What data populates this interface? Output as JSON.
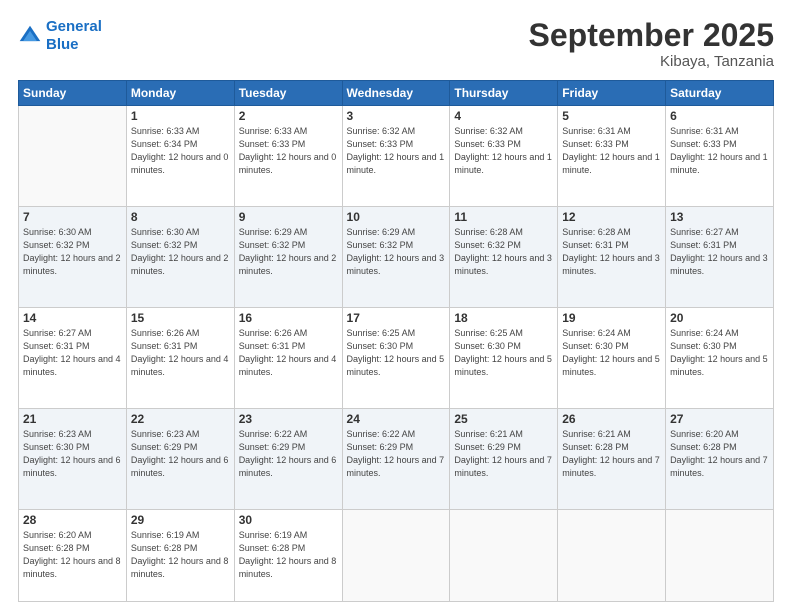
{
  "logo": {
    "line1": "General",
    "line2": "Blue"
  },
  "title": "September 2025",
  "location": "Kibaya, Tanzania",
  "headers": [
    "Sunday",
    "Monday",
    "Tuesday",
    "Wednesday",
    "Thursday",
    "Friday",
    "Saturday"
  ],
  "weeks": [
    [
      {
        "day": "",
        "sunrise": "",
        "sunset": "",
        "daylight": ""
      },
      {
        "day": "1",
        "sunrise": "Sunrise: 6:33 AM",
        "sunset": "Sunset: 6:34 PM",
        "daylight": "Daylight: 12 hours and 0 minutes."
      },
      {
        "day": "2",
        "sunrise": "Sunrise: 6:33 AM",
        "sunset": "Sunset: 6:33 PM",
        "daylight": "Daylight: 12 hours and 0 minutes."
      },
      {
        "day": "3",
        "sunrise": "Sunrise: 6:32 AM",
        "sunset": "Sunset: 6:33 PM",
        "daylight": "Daylight: 12 hours and 1 minute."
      },
      {
        "day": "4",
        "sunrise": "Sunrise: 6:32 AM",
        "sunset": "Sunset: 6:33 PM",
        "daylight": "Daylight: 12 hours and 1 minute."
      },
      {
        "day": "5",
        "sunrise": "Sunrise: 6:31 AM",
        "sunset": "Sunset: 6:33 PM",
        "daylight": "Daylight: 12 hours and 1 minute."
      },
      {
        "day": "6",
        "sunrise": "Sunrise: 6:31 AM",
        "sunset": "Sunset: 6:33 PM",
        "daylight": "Daylight: 12 hours and 1 minute."
      }
    ],
    [
      {
        "day": "7",
        "sunrise": "Sunrise: 6:30 AM",
        "sunset": "Sunset: 6:32 PM",
        "daylight": "Daylight: 12 hours and 2 minutes."
      },
      {
        "day": "8",
        "sunrise": "Sunrise: 6:30 AM",
        "sunset": "Sunset: 6:32 PM",
        "daylight": "Daylight: 12 hours and 2 minutes."
      },
      {
        "day": "9",
        "sunrise": "Sunrise: 6:29 AM",
        "sunset": "Sunset: 6:32 PM",
        "daylight": "Daylight: 12 hours and 2 minutes."
      },
      {
        "day": "10",
        "sunrise": "Sunrise: 6:29 AM",
        "sunset": "Sunset: 6:32 PM",
        "daylight": "Daylight: 12 hours and 3 minutes."
      },
      {
        "day": "11",
        "sunrise": "Sunrise: 6:28 AM",
        "sunset": "Sunset: 6:32 PM",
        "daylight": "Daylight: 12 hours and 3 minutes."
      },
      {
        "day": "12",
        "sunrise": "Sunrise: 6:28 AM",
        "sunset": "Sunset: 6:31 PM",
        "daylight": "Daylight: 12 hours and 3 minutes."
      },
      {
        "day": "13",
        "sunrise": "Sunrise: 6:27 AM",
        "sunset": "Sunset: 6:31 PM",
        "daylight": "Daylight: 12 hours and 3 minutes."
      }
    ],
    [
      {
        "day": "14",
        "sunrise": "Sunrise: 6:27 AM",
        "sunset": "Sunset: 6:31 PM",
        "daylight": "Daylight: 12 hours and 4 minutes."
      },
      {
        "day": "15",
        "sunrise": "Sunrise: 6:26 AM",
        "sunset": "Sunset: 6:31 PM",
        "daylight": "Daylight: 12 hours and 4 minutes."
      },
      {
        "day": "16",
        "sunrise": "Sunrise: 6:26 AM",
        "sunset": "Sunset: 6:31 PM",
        "daylight": "Daylight: 12 hours and 4 minutes."
      },
      {
        "day": "17",
        "sunrise": "Sunrise: 6:25 AM",
        "sunset": "Sunset: 6:30 PM",
        "daylight": "Daylight: 12 hours and 5 minutes."
      },
      {
        "day": "18",
        "sunrise": "Sunrise: 6:25 AM",
        "sunset": "Sunset: 6:30 PM",
        "daylight": "Daylight: 12 hours and 5 minutes."
      },
      {
        "day": "19",
        "sunrise": "Sunrise: 6:24 AM",
        "sunset": "Sunset: 6:30 PM",
        "daylight": "Daylight: 12 hours and 5 minutes."
      },
      {
        "day": "20",
        "sunrise": "Sunrise: 6:24 AM",
        "sunset": "Sunset: 6:30 PM",
        "daylight": "Daylight: 12 hours and 5 minutes."
      }
    ],
    [
      {
        "day": "21",
        "sunrise": "Sunrise: 6:23 AM",
        "sunset": "Sunset: 6:30 PM",
        "daylight": "Daylight: 12 hours and 6 minutes."
      },
      {
        "day": "22",
        "sunrise": "Sunrise: 6:23 AM",
        "sunset": "Sunset: 6:29 PM",
        "daylight": "Daylight: 12 hours and 6 minutes."
      },
      {
        "day": "23",
        "sunrise": "Sunrise: 6:22 AM",
        "sunset": "Sunset: 6:29 PM",
        "daylight": "Daylight: 12 hours and 6 minutes."
      },
      {
        "day": "24",
        "sunrise": "Sunrise: 6:22 AM",
        "sunset": "Sunset: 6:29 PM",
        "daylight": "Daylight: 12 hours and 7 minutes."
      },
      {
        "day": "25",
        "sunrise": "Sunrise: 6:21 AM",
        "sunset": "Sunset: 6:29 PM",
        "daylight": "Daylight: 12 hours and 7 minutes."
      },
      {
        "day": "26",
        "sunrise": "Sunrise: 6:21 AM",
        "sunset": "Sunset: 6:28 PM",
        "daylight": "Daylight: 12 hours and 7 minutes."
      },
      {
        "day": "27",
        "sunrise": "Sunrise: 6:20 AM",
        "sunset": "Sunset: 6:28 PM",
        "daylight": "Daylight: 12 hours and 7 minutes."
      }
    ],
    [
      {
        "day": "28",
        "sunrise": "Sunrise: 6:20 AM",
        "sunset": "Sunset: 6:28 PM",
        "daylight": "Daylight: 12 hours and 8 minutes."
      },
      {
        "day": "29",
        "sunrise": "Sunrise: 6:19 AM",
        "sunset": "Sunset: 6:28 PM",
        "daylight": "Daylight: 12 hours and 8 minutes."
      },
      {
        "day": "30",
        "sunrise": "Sunrise: 6:19 AM",
        "sunset": "Sunset: 6:28 PM",
        "daylight": "Daylight: 12 hours and 8 minutes."
      },
      {
        "day": "",
        "sunrise": "",
        "sunset": "",
        "daylight": ""
      },
      {
        "day": "",
        "sunrise": "",
        "sunset": "",
        "daylight": ""
      },
      {
        "day": "",
        "sunrise": "",
        "sunset": "",
        "daylight": ""
      },
      {
        "day": "",
        "sunrise": "",
        "sunset": "",
        "daylight": ""
      }
    ]
  ]
}
